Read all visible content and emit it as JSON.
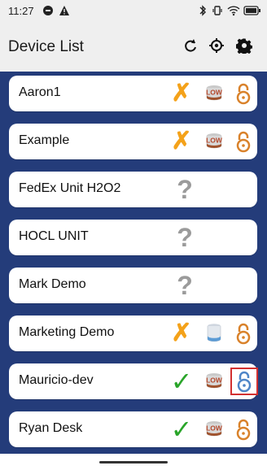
{
  "status": {
    "time": "11:27",
    "icons": [
      "dnd-icon",
      "alert-icon",
      "bluetooth-icon",
      "vibrate-icon",
      "wifi-icon",
      "battery-icon"
    ]
  },
  "appbar": {
    "title": "Device List",
    "actions": [
      "refresh-icon",
      "locate-icon",
      "settings-icon"
    ]
  },
  "devices": [
    {
      "name": "Aaron1",
      "status": "x",
      "level": "low",
      "lock": "unlocked-orange"
    },
    {
      "name": "Example",
      "status": "x",
      "level": "low",
      "lock": "unlocked-orange"
    },
    {
      "name": "FedEx Unit H2O2",
      "status": "unknown",
      "level": "",
      "lock": ""
    },
    {
      "name": "HOCL UNIT",
      "status": "unknown",
      "level": "",
      "lock": ""
    },
    {
      "name": "Mark Demo",
      "status": "unknown",
      "level": "",
      "lock": ""
    },
    {
      "name": "Marketing Demo",
      "status": "x",
      "level": "ok",
      "lock": "unlocked-orange"
    },
    {
      "name": "Mauricio-dev",
      "status": "check",
      "level": "low",
      "lock": "selected-blue"
    },
    {
      "name": "Ryan Desk",
      "status": "check",
      "level": "low",
      "lock": "unlocked-orange"
    }
  ],
  "labels": {
    "low": "LOW"
  },
  "colors": {
    "navy": "#243c7a",
    "orange": "#f4a21a",
    "green": "#2aa52a",
    "gray": "#9b9b9b",
    "lock_orange": "#d9822b",
    "lock_blue": "#4f86c8"
  }
}
